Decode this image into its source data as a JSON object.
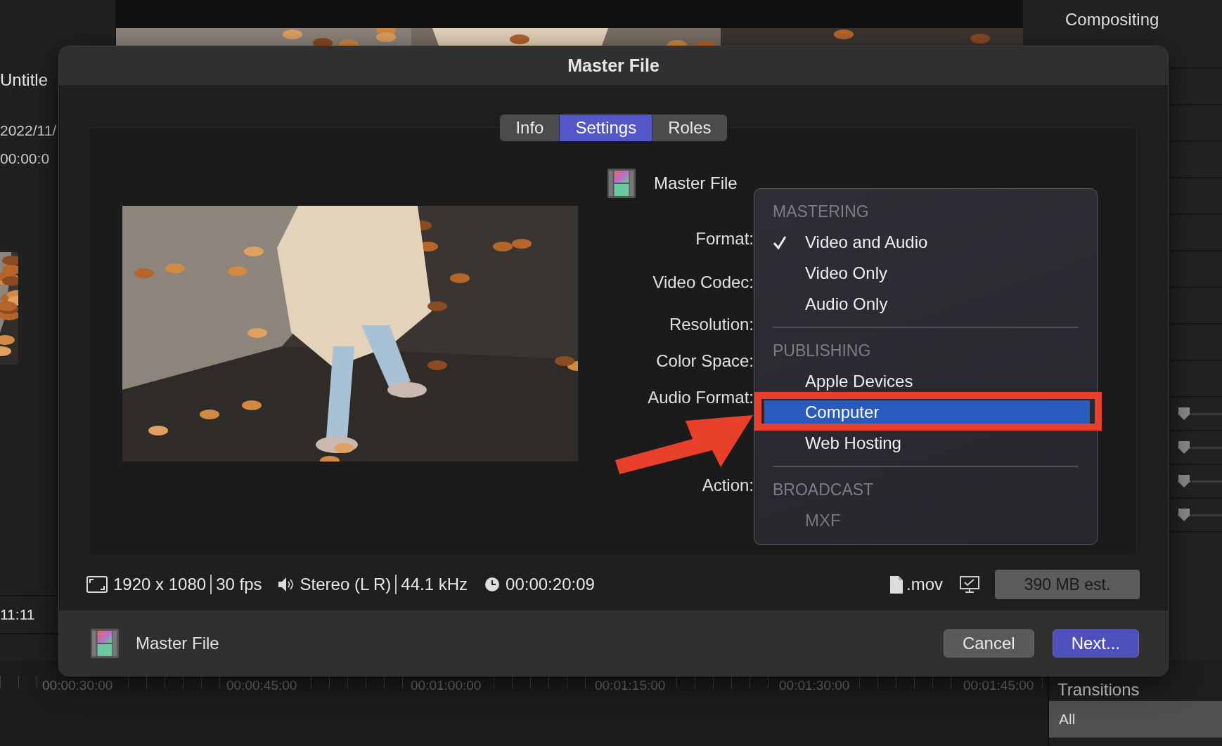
{
  "app": {
    "project_title": "Untitle",
    "date": "2022/11/",
    "timecode": "00:00:0",
    "playhead_time": "11:11",
    "inspector": {
      "title": "Compositing",
      "sliders": [
        {
          "level": 0
        },
        {
          "level": 0
        },
        {
          "level": 0
        },
        {
          "level": 0
        }
      ]
    },
    "timeline_ruler": [
      "00:00:30:00",
      "00:00:45:00",
      "00:01:00:00",
      "00:01:15:00",
      "00:01:30:00",
      "00:01:45:00"
    ],
    "browser": {
      "title": "Transitions",
      "items": [
        {
          "label": "All",
          "selected": true
        }
      ]
    }
  },
  "dialog": {
    "title": "Master File",
    "tabs": [
      {
        "label": "Info",
        "selected": false
      },
      {
        "label": "Settings",
        "selected": true
      },
      {
        "label": "Roles",
        "selected": false
      }
    ],
    "destination_name": "Master File",
    "field_labels": [
      "Format:",
      "Video Codec:",
      "Resolution:",
      "Color Space:",
      "Audio Format:",
      "Action:"
    ],
    "menu": [
      {
        "heading": "MASTERING",
        "items": [
          {
            "label": "Video and Audio",
            "checked": true,
            "selected": false,
            "disabled": false
          },
          {
            "label": "Video Only",
            "checked": false,
            "selected": false,
            "disabled": false
          },
          {
            "label": "Audio Only",
            "checked": false,
            "selected": false,
            "disabled": false
          }
        ]
      },
      {
        "heading": "PUBLISHING",
        "items": [
          {
            "label": "Apple Devices",
            "checked": false,
            "selected": false,
            "disabled": false
          },
          {
            "label": "Computer",
            "checked": false,
            "selected": true,
            "disabled": false
          },
          {
            "label": "Web Hosting",
            "checked": false,
            "selected": false,
            "disabled": false
          }
        ]
      },
      {
        "heading": "BROADCAST",
        "items": [
          {
            "label": "MXF",
            "checked": false,
            "selected": false,
            "disabled": true
          }
        ]
      }
    ],
    "info_bar": {
      "resolution": "1920 x 1080",
      "frame_rate": "30 fps",
      "audio": "Stereo (L R)",
      "sample_rate": "44.1 kHz",
      "duration": "00:00:20:09",
      "extension": ".mov",
      "size": "390 MB est."
    },
    "footer": {
      "name": "Master File",
      "buttons": [
        {
          "label": "Cancel",
          "kind": "secondary"
        },
        {
          "label": "Next...",
          "kind": "primary"
        }
      ]
    }
  }
}
